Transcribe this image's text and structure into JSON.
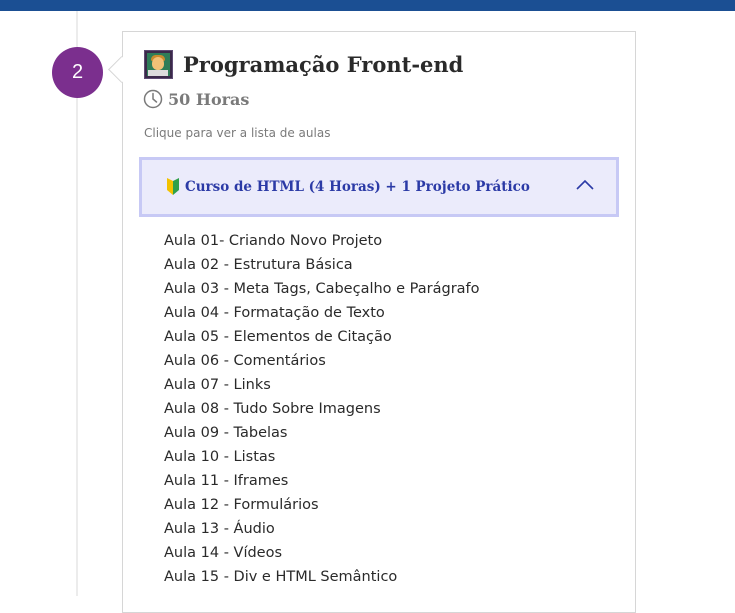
{
  "step": {
    "number": "2"
  },
  "course": {
    "title": "Programação Front-end",
    "icon": "technologist-icon",
    "duration": "50 Horas",
    "hint": "Clique para ver a lista de aulas"
  },
  "accordion": {
    "title": "Curso de HTML (4 Horas) + 1 Projeto Prático",
    "expanded": true,
    "lessons": [
      "Aula 01- Criando Novo Projeto",
      "Aula 02 - Estrutura Básica",
      "Aula 03 - Meta Tags, Cabeçalho e Parágrafo",
      "Aula 04 - Formatação de Texto",
      "Aula 05 - Elementos de Citação",
      "Aula 06 - Comentários",
      "Aula 07 - Links",
      "Aula 08 - Tudo Sobre Imagens",
      "Aula 09 - Tabelas",
      "Aula 10 - Listas",
      "Aula 11 - Iframes",
      "Aula 12 - Formulários",
      "Aula 13 - Áudio",
      "Aula 14 - Vídeos",
      "Aula 15 - Div e HTML Semântico"
    ]
  },
  "colors": {
    "top_bar": "#1b4f93",
    "badge": "#7b2f8e",
    "accordion_bg": "#ebebfb",
    "accordion_border": "#c7c9f5",
    "accordion_text": "#2b3aa6"
  }
}
